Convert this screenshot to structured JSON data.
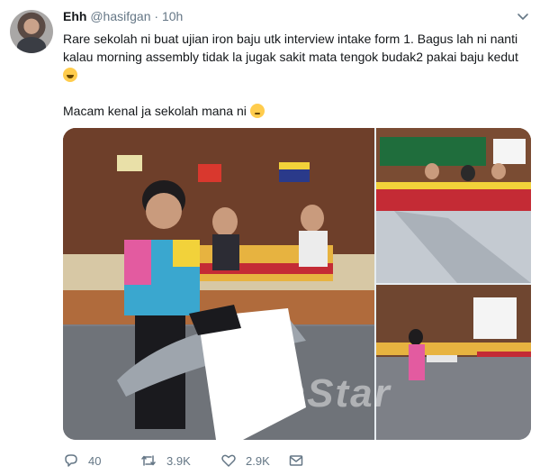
{
  "tweet": {
    "display_name": "Ehh",
    "handle": "@hasifgan",
    "separator": "·",
    "time": "10h",
    "text_line1": "Rare sekolah ni buat ujian iron baju utk interview intake form 1. Bagus lah ni nanti kalau morning assembly tidak la jugak sakit mata tengok budak2 pakai baju kedut",
    "text_line2": "Macam kenal ja sekolah mana ni",
    "emoji1": "face-with-tears-of-joy-icon",
    "emoji2": "thinking-face-icon",
    "media_watermark": "mStar",
    "media_count": 3
  },
  "actions": {
    "replies": "40",
    "retweets": "3.9K",
    "likes": "2.9K"
  },
  "icons": {
    "reply": "reply-icon",
    "retweet": "retweet-icon",
    "like": "heart-icon",
    "share": "envelope-icon",
    "menu": "chevron-down-icon"
  },
  "colors": {
    "text": "#14171a",
    "secondary": "#657786",
    "background": "#ffffff"
  }
}
